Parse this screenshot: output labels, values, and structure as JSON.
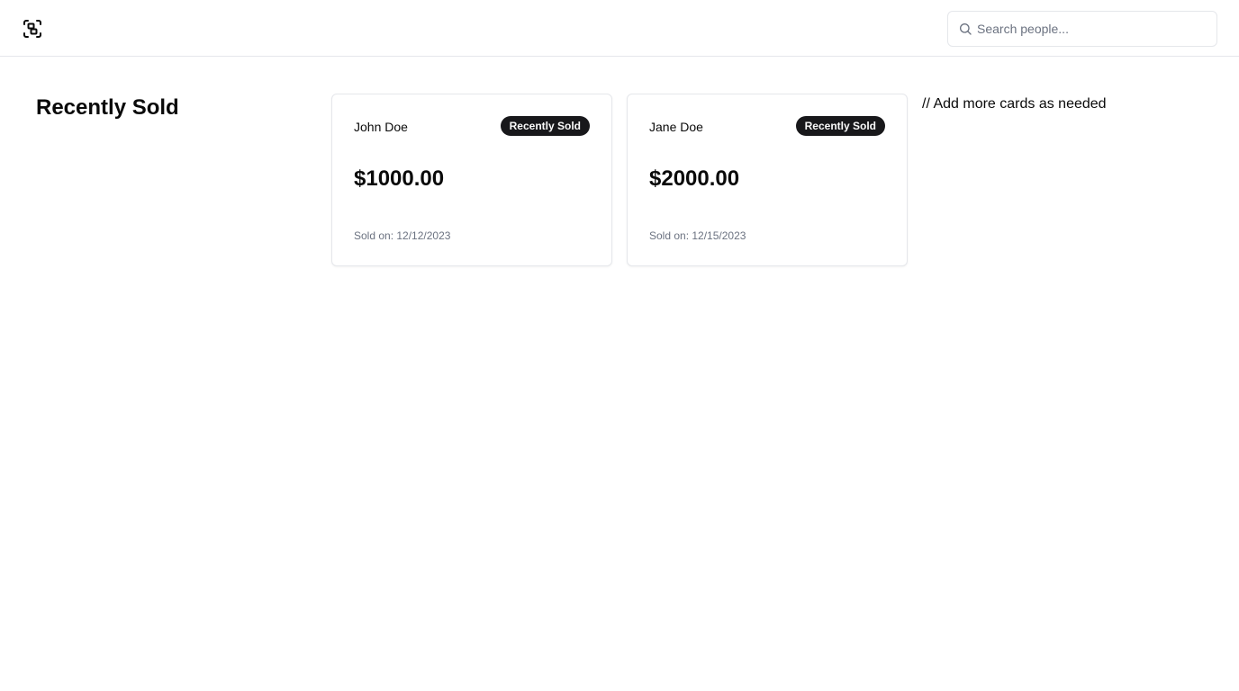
{
  "header": {
    "logo_icon": "scan-face-icon",
    "search": {
      "icon": "search-icon",
      "placeholder": "Search people...",
      "value": ""
    }
  },
  "main": {
    "title": "Recently Sold",
    "cards": [
      {
        "name": "John Doe",
        "badge": "Recently Sold",
        "price": "$1000.00",
        "sold_on": "Sold on: 12/12/2023"
      },
      {
        "name": "Jane Doe",
        "badge": "Recently Sold",
        "price": "$2000.00",
        "sold_on": "Sold on: 12/15/2023"
      }
    ],
    "comment": "// Add more cards as needed"
  },
  "colors": {
    "badge_background": "#18181b",
    "badge_text": "#fafafa",
    "border": "#e5e7eb",
    "muted_text": "#6b7280"
  }
}
